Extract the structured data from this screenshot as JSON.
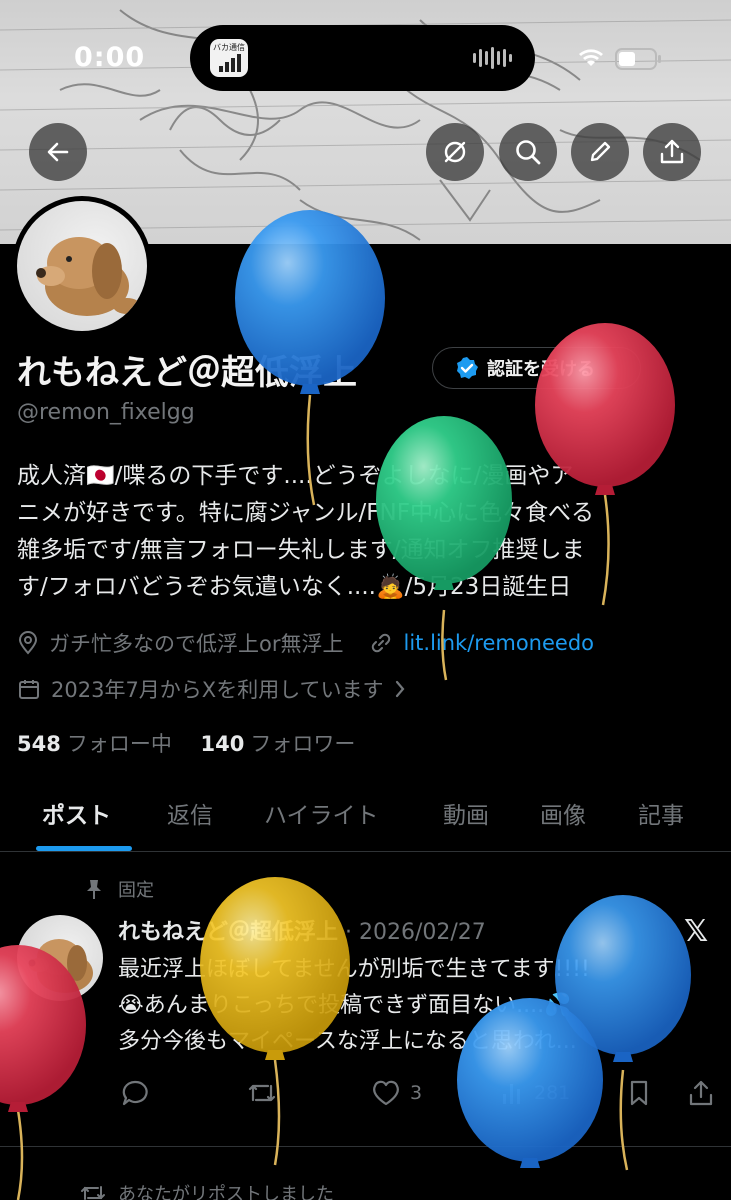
{
  "status_bar": {
    "time": "0:00",
    "island_app_label": "バカ通信"
  },
  "profile": {
    "display_name": "れもねえど＠超低浮上",
    "verify_button": "認証を受ける",
    "handle": "@remon_fixelgg",
    "bio_lines": [
      "成人済🇯🇵/喋るの下手です....どうぞよしなに/漫画やア",
      "ニメが好きです。特に腐ジャンル/FNF中心に色々食べる",
      "雑多垢です/無言フォロー失礼します/通知オフ推奨しま",
      "す/フォロバどうぞお気遣いなく....🙇/5月23日誕生日"
    ],
    "location": "ガチ忙多なので低浮上or無浮上",
    "link": "lit.link/remoneedo",
    "joined": "2023年7月からXを利用しています",
    "following_count": "548",
    "following_label": "フォロー中",
    "followers_count": "140",
    "followers_label": "フォロワー"
  },
  "tabs": [
    "ポスト",
    "返信",
    "ハイライト",
    "動画",
    "画像",
    "記事"
  ],
  "active_tab": "ポスト",
  "pinned_post": {
    "pinned_label": "固定",
    "author": "れもねえど＠超低浮上",
    "date": "2026/02/27",
    "text_lines": [
      "最近浮上ほぼしてませんが別垢で生きてます!!!!",
      "😭あんまりこっちで投稿できず面目ない....💦",
      "多分今後もマイペースな浮上になると思われ..."
    ],
    "likes": "3",
    "views": "281"
  },
  "next_item": {
    "reposted_label": "あなたがリポストしました"
  },
  "colors": {
    "accent": "#1d9bf0",
    "muted": "#72767a",
    "balloon_blue": "#2e8fe6",
    "balloon_red": "#e0384f",
    "balloon_green": "#2ecb86",
    "balloon_yellow": "#f2c21f"
  },
  "icons": [
    "back-arrow-icon",
    "hide-icon",
    "search-icon",
    "edit-icon",
    "share-icon",
    "location-icon",
    "link-icon",
    "calendar-icon",
    "pin-icon",
    "reply-icon",
    "repost-icon",
    "like-icon",
    "views-icon",
    "bookmark-icon",
    "share-icon",
    "x-logo-icon"
  ]
}
